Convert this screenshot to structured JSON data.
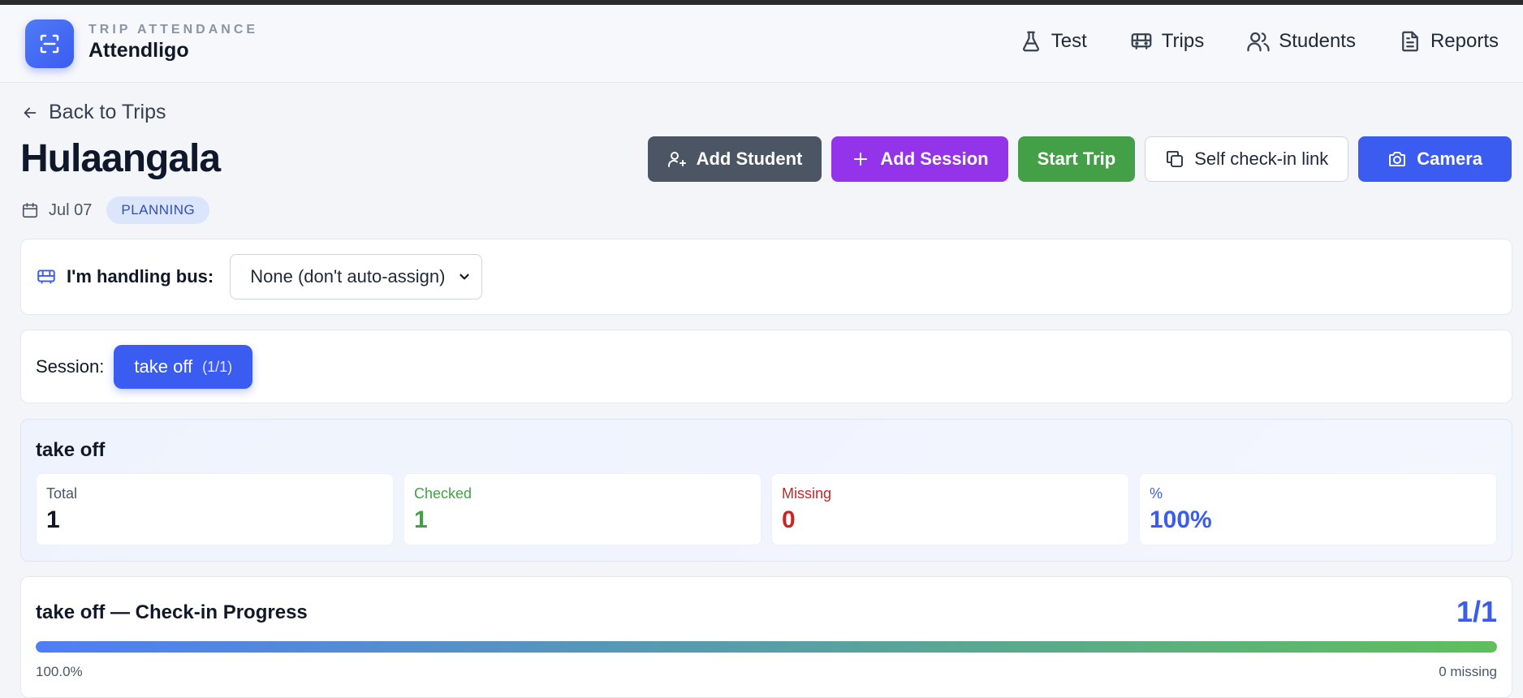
{
  "header": {
    "kicker": "TRIP ATTENDANCE",
    "brand": "Attendligo",
    "nav": [
      {
        "label": "Test",
        "icon": "flask-icon"
      },
      {
        "label": "Trips",
        "icon": "bus-icon"
      },
      {
        "label": "Students",
        "icon": "users-icon"
      },
      {
        "label": "Reports",
        "icon": "document-icon"
      }
    ]
  },
  "page": {
    "back_label": "Back to Trips",
    "title": "Hulaangala",
    "date": "Jul 07",
    "status": "PLANNING"
  },
  "actions": {
    "add_student": "Add Student",
    "add_session": "Add Session",
    "start_trip": "Start Trip",
    "self_checkin": "Self check-in link",
    "camera": "Camera"
  },
  "bus": {
    "label": "I'm handling bus:",
    "selected": "None (don't auto-assign)"
  },
  "session": {
    "label": "Session:",
    "active": "take off",
    "count": "(1/1)"
  },
  "stats": {
    "title": "take off",
    "items": [
      {
        "label": "Total",
        "value": "1"
      },
      {
        "label": "Checked",
        "value": "1"
      },
      {
        "label": "Missing",
        "value": "0"
      },
      {
        "label": "%",
        "value": "100%"
      }
    ]
  },
  "progress": {
    "title": "take off — Check-in Progress",
    "count": "1/1",
    "fraction": 1.0,
    "percent_text": "100.0%",
    "missing_text": "0 missing"
  },
  "colors": {
    "accent": "#3b5cf0",
    "purple": "#9333ea",
    "green": "#43a047",
    "checked": "#43a047",
    "missing": "#c62828",
    "percent": "#3b5cf0"
  }
}
